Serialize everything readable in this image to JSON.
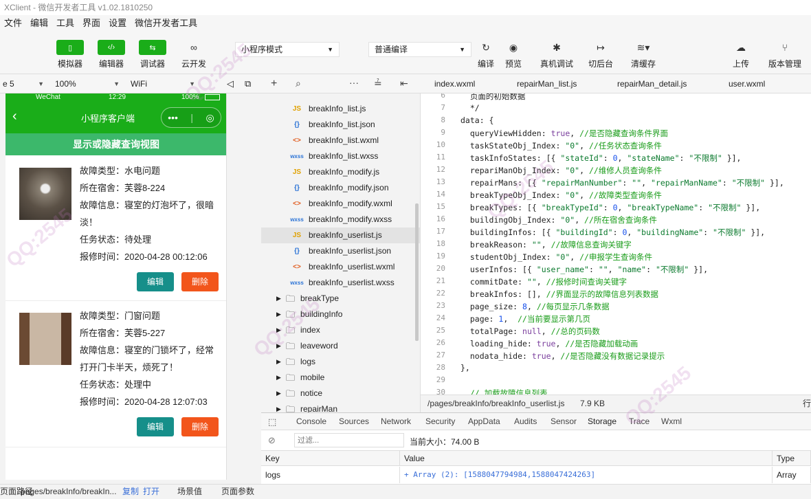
{
  "window": {
    "title": "XClient - 微信开发者工具 v1.02.1810250"
  },
  "menu": [
    "文件",
    "编辑",
    "工具",
    "界面",
    "设置",
    "微信开发者工具"
  ],
  "toolbar": {
    "simulator": "模拟器",
    "editor": "编辑器",
    "debugger": "调试器",
    "cloud": "云开发",
    "mode_select": "小程序模式",
    "compile_select": "普通编译",
    "compile": "编译",
    "preview": "预览",
    "device_debug": "真机调试",
    "background": "切后台",
    "clear_cache": "清缓存",
    "upload": "上传",
    "version": "版本管理"
  },
  "sim_strip": {
    "device": "e 5",
    "zoom": "100%",
    "network": "WiFi"
  },
  "phone": {
    "status": {
      "carrier": "WeChat",
      "time": "12:29",
      "battery": "100%"
    },
    "nav_title": "小程序客户端",
    "toggle_label": "显示或隐藏查询视图",
    "edit_label": "编辑",
    "delete_label": "删除",
    "cards": [
      {
        "type": "故障类型：水电问题",
        "dorm": "所在宿舍：芙蓉8-224",
        "desc1": "故障信息：寝室的灯泡坏了，很暗",
        "desc2": "淡！",
        "state": "任务状态：待处理",
        "time": "报修时间：2020-04-28 00:12:06"
      },
      {
        "type": "故障类型：门窗问题",
        "dorm": "所在宿舍：芙蓉5-227",
        "desc1": "故障信息：寝室的门锁坏了，经常",
        "desc2": "打开门卡半天，烦死了！",
        "state": "任务状态：处理中",
        "time": "报修时间：2020-04-28 12:07:03"
      }
    ]
  },
  "files": [
    {
      "icon": "JS",
      "name": "breakInfo_list.js",
      "kind": "js"
    },
    {
      "icon": "{}",
      "name": "breakInfo_list.json",
      "kind": "json"
    },
    {
      "icon": "<>",
      "name": "breakInfo_list.wxml",
      "kind": "wxml"
    },
    {
      "icon": "wxss",
      "name": "breakInfo_list.wxss",
      "kind": "wxss"
    },
    {
      "icon": "JS",
      "name": "breakInfo_modify.js",
      "kind": "js"
    },
    {
      "icon": "{}",
      "name": "breakInfo_modify.json",
      "kind": "json"
    },
    {
      "icon": "<>",
      "name": "breakInfo_modify.wxml",
      "kind": "wxml"
    },
    {
      "icon": "wxss",
      "name": "breakInfo_modify.wxss",
      "kind": "wxss"
    },
    {
      "icon": "JS",
      "name": "breakInfo_userlist.js",
      "kind": "js",
      "selected": true
    },
    {
      "icon": "{}",
      "name": "breakInfo_userlist.json",
      "kind": "json"
    },
    {
      "icon": "<>",
      "name": "breakInfo_userlist.wxml",
      "kind": "wxml"
    },
    {
      "icon": "wxss",
      "name": "breakInfo_userlist.wxss",
      "kind": "wxss"
    }
  ],
  "folders": [
    "breakType",
    "buildingInfo",
    "index",
    "leaveword",
    "logs",
    "mobile",
    "notice",
    "repairMan"
  ],
  "editor_tabs": [
    "index.wxml",
    "repairMan_list.js",
    "repairMan_detail.js",
    "user.wxml"
  ],
  "code_lines": [
    {
      "n": "6",
      "t": "  页面的初始数据"
    },
    {
      "n": "7",
      "t": "  */"
    },
    {
      "n": "8",
      "t": "data: {"
    },
    {
      "n": "9",
      "t": "  queryViewHidden: true, //是否隐藏查询条件界面"
    },
    {
      "n": "10",
      "t": "  taskStateObj_Index: \"0\", //任务状态查询条件"
    },
    {
      "n": "11",
      "t": "  taskInfoStates: [{ \"stateId\": 0, \"stateName\": \"不限制\" }],"
    },
    {
      "n": "12",
      "t": "  repariManObj_Index: \"0\", //维修人员查询条件"
    },
    {
      "n": "13",
      "t": "  repairMans: [{ \"repairManNumber\": \"\", \"repairManName\": \"不限制\" }],"
    },
    {
      "n": "14",
      "t": "  breakTypeObj_Index: \"0\", //故障类型查询条件"
    },
    {
      "n": "15",
      "t": "  breakTypes: [{ \"breakTypeId\": 0, \"breakTypeName\": \"不限制\" }],"
    },
    {
      "n": "16",
      "t": "  buildingObj_Index: \"0\", //所在宿舍查询条件"
    },
    {
      "n": "17",
      "t": "  buildingInfos: [{ \"buildingId\": 0, \"buildingName\": \"不限制\" }],"
    },
    {
      "n": "18",
      "t": "  breakReason: \"\", //故障信息查询关键字"
    },
    {
      "n": "19",
      "t": "  studentObj_Index: \"0\", //申报学生查询条件"
    },
    {
      "n": "20",
      "t": "  userInfos: [{ \"user_name\": \"\", \"name\": \"不限制\" }],"
    },
    {
      "n": "21",
      "t": "  commitDate: \"\", //报修时间查询关键字"
    },
    {
      "n": "22",
      "t": "  breakInfos: [], //界面显示的故障信息列表数据"
    },
    {
      "n": "23",
      "t": "  page_size: 8, //每页显示几条数据"
    },
    {
      "n": "24",
      "t": "  page: 1,  //当前要显示第几页"
    },
    {
      "n": "25",
      "t": "  totalPage: null, //总的页码数"
    },
    {
      "n": "26",
      "t": "  loading_hide: true, //是否隐藏加载动画"
    },
    {
      "n": "27",
      "t": "  nodata_hide: true, //是否隐藏没有数据记录提示"
    },
    {
      "n": "28",
      "t": "},"
    },
    {
      "n": "29",
      "t": ""
    },
    {
      "n": "30",
      "t": "  // 加载故障信息列表"
    }
  ],
  "editor_status": {
    "path": "/pages/breakInfo/breakInfo_userlist.js",
    "size": "7.9 KB",
    "extra": "行"
  },
  "devtools": {
    "tabs": [
      "Console",
      "Sources",
      "Network",
      "Security",
      "AppData",
      "Audits",
      "Sensor",
      "Storage",
      "Trace",
      "Wxml"
    ],
    "active_tab": "Storage",
    "filter_placeholder": "过滤...",
    "current_size": "当前大小：74.00 B",
    "columns": [
      "Key",
      "Value",
      "Type"
    ],
    "row": {
      "key": "logs",
      "value": "+ Array (2): [1588047794984,1588047424263]",
      "type": "Array"
    }
  },
  "bottombar": {
    "label": "页面路径",
    "path": "pages/breakInfo/breakIn...",
    "copy": "复制",
    "open": "打开",
    "scene": "场景值",
    "params": "页面参数"
  },
  "watermark_text": "QQ:2545"
}
